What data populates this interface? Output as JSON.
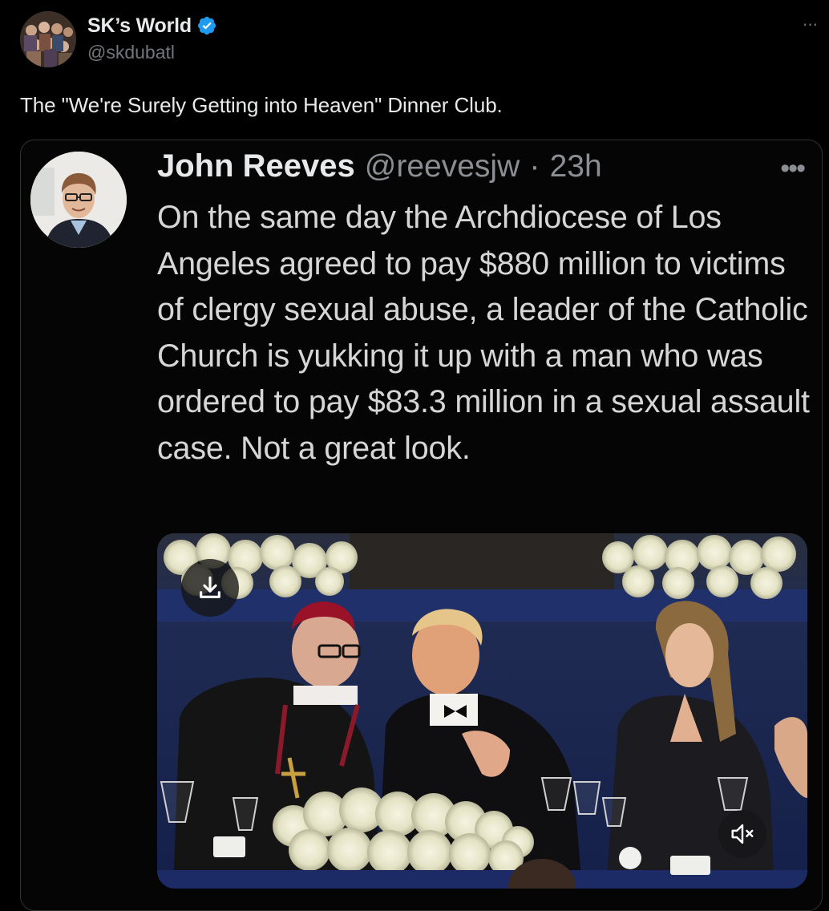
{
  "post": {
    "author_name": "SK’s World",
    "author_handle": "@skdubatl",
    "text": "The \"We're Surely Getting into Heaven\" Dinner Club.",
    "more_glyph": "···"
  },
  "quoted": {
    "author_name": "John Reeves",
    "author_handle": "@reevesjw",
    "separator": "·",
    "time": "23h",
    "more_glyph": "•••",
    "text": "On the same day the Archdiocese of Los Angeles agreed to pay $880 million to victims of clergy sexual abuse, a leader of the Catholic Church is yukking it up with a man who was ordered to pay $83.3 million in a sexual assault case. Not a great look."
  },
  "media": {
    "download_icon": "download-icon",
    "mute_icon": "speaker-muted-icon"
  },
  "colors": {
    "background": "#000000",
    "text": "#e7e9ea",
    "secondary": "#71767b",
    "verified": "#1d9bf0",
    "card_border": "#2f3336"
  }
}
